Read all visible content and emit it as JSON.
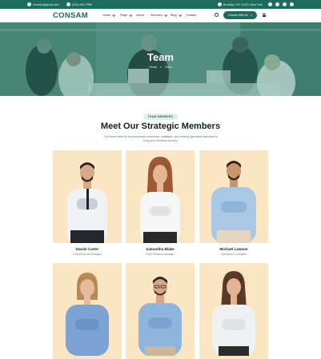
{
  "topbar": {
    "email": "consam@gmail.com",
    "phone": "(000) 444-7998",
    "address": "Brooklyn, NY 11202, New York"
  },
  "nav": {
    "logo": "CONSAM",
    "menu": [
      "Home",
      "Page",
      "About",
      "Services",
      "Blog",
      "Contact"
    ],
    "cta": "Consult With Us"
  },
  "hero": {
    "title": "Team",
    "breadcrumb_home": "Home",
    "breadcrumb_sep": "»",
    "breadcrumb_current": "Team"
  },
  "section": {
    "badge": "TEAM MEMBERS",
    "heading": "Meet Our Strategic Members",
    "subtitle": "Our teams meet us of promotional consultants, strategies, and industry specialists dedicated to bring your business success."
  },
  "members": [
    {
      "name": "Daniel Carter",
      "role": "Lead Business Strategist"
    },
    {
      "name": "Samantha Blake",
      "role": "Client Relations Manager"
    },
    {
      "name": "Michael Lawson",
      "role": "Operations Consultant"
    },
    {
      "name": "",
      "role": ""
    },
    {
      "name": "",
      "role": ""
    },
    {
      "name": "",
      "role": ""
    }
  ],
  "colors": {
    "brand": "#1f6b5b",
    "card_bg": "#fbe6c3"
  }
}
